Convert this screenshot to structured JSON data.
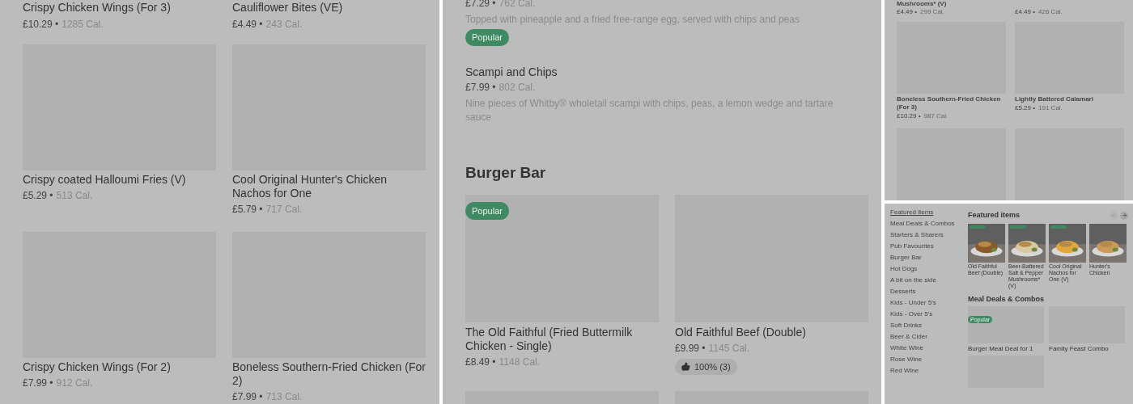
{
  "left_panel": {
    "items": [
      {
        "kind": "text_only",
        "name": "Crispy Chicken Wings (For 3)",
        "price": "£10.29 •",
        "calories": "1285 Cal."
      },
      {
        "kind": "text_only",
        "name": "Cauliflower Bites (VE)",
        "price": "£4.49 •",
        "calories": "243 Cal."
      },
      {
        "kind": "card",
        "name": "Crispy coated Halloumi Fries (V)",
        "price": "£5.29 •",
        "calories": "513 Cal."
      },
      {
        "kind": "card",
        "name": "Cool Original Hunter's Chicken Nachos for One",
        "price": "£5.79 •",
        "calories": "717 Cal."
      },
      {
        "kind": "card",
        "name": "Crispy Chicken Wings (For 2)",
        "price": "£7.99 •",
        "calories": "912 Cal."
      },
      {
        "kind": "card",
        "name": "Boneless Southern-Fried Chicken (For 2)",
        "price": "£7.99 •",
        "calories": "713 Cal."
      }
    ]
  },
  "middle_panel": {
    "list_items": [
      {
        "price": "£7.29 •",
        "calories": "762 Cal.",
        "description": "Topped with pineapple and a fried free-range egg, served with chips and peas",
        "badge": "Popular"
      },
      {
        "name": "Scampi and Chips",
        "price": "£7.99 •",
        "calories": "802 Cal.",
        "description": "Nine pieces of Whitby® wholetail scampi with chips, peas, a lemon wedge and tartare sauce"
      }
    ],
    "section_title": "Burger Bar",
    "cards": [
      {
        "name": "The Old Faithful (Fried Buttermilk Chicken - Single)",
        "price": "£8.49 •",
        "calories": "1148 Cal.",
        "badge": "Popular"
      },
      {
        "name": "Old Faithful Beef (Double)",
        "price": "£9.99 •",
        "calories": "1145 Cal.",
        "rating": "100% (3)"
      }
    ]
  },
  "right_top_panel": {
    "items": [
      {
        "name": "Mushrooms* (V)",
        "price": "£4.49 •",
        "calories": "299 Cal."
      },
      {
        "price": "£4.49 •",
        "calories": "426 Cal."
      },
      {
        "name": "Boneless Southern-Fried Chicken (For 3)",
        "price": "£10.29 •",
        "calories": "987 Cal."
      },
      {
        "name": "Lightly Battered Calamari",
        "price": "£5.29 •",
        "calories": "191 Cal."
      }
    ]
  },
  "right_bottom_panel": {
    "sidebar": {
      "items": [
        {
          "label": "Featured items",
          "selected": true
        },
        {
          "label": "Meal Deals & Combos",
          "selected": false
        },
        {
          "label": "Starters & Sharers",
          "selected": false
        },
        {
          "label": "Pub Favourites",
          "selected": false
        },
        {
          "label": "Burger Bar",
          "selected": false
        },
        {
          "label": "Hot Dogs",
          "selected": false
        },
        {
          "label": "A bit on the side",
          "selected": false
        },
        {
          "label": "Desserts",
          "selected": false
        },
        {
          "label": "Kids - Under 5's",
          "selected": false
        },
        {
          "label": "Kids - Over 5's",
          "selected": false
        },
        {
          "label": "Soft Drinks",
          "selected": false
        },
        {
          "label": "Beer & Cider",
          "selected": false
        },
        {
          "label": "White Wine",
          "selected": false
        },
        {
          "label": "Rose Wine",
          "selected": false
        },
        {
          "label": "Red Wine",
          "selected": false
        }
      ]
    },
    "featured": {
      "title": "Featured items",
      "items": [
        {
          "name": "Old Faithful Beef (Double)",
          "badge": true
        },
        {
          "name": "Beer-Battered Salt & Pepper Mushrooms* (V)",
          "badge": true
        },
        {
          "name": "Cool Original Nachos for One (V)",
          "badge": true
        },
        {
          "name": "Hunter's Chicken",
          "badge": false
        }
      ]
    },
    "meal_deals": {
      "title": "Meal Deals & Combos",
      "items": [
        {
          "name": "Burger Meal Deal for 1",
          "badge": "Popular"
        },
        {
          "name": "Family Feast Combo"
        }
      ]
    }
  }
}
